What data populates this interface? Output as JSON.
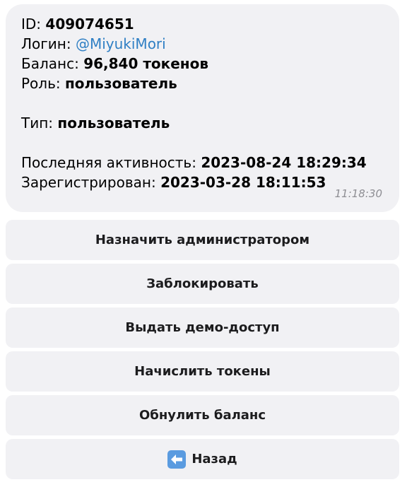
{
  "profile": {
    "id_label": "ID:",
    "id_value": "409074651",
    "login_label": "Логин:",
    "login_value": "@MiyukiMori",
    "balance_label": "Баланс:",
    "balance_value": "96,840 токенов",
    "role_label": "Роль:",
    "role_value": "пользователь",
    "type_label": "Тип:",
    "type_value": "пользователь",
    "last_active_label": "Последняя активность:",
    "last_active_value": "2023-08-24 18:29:34",
    "registered_label": "Зарегистрирован:",
    "registered_value": "2023-03-28 18:11:53",
    "time": "11:18:30"
  },
  "buttons": {
    "make_admin": "Назначить администратором",
    "block": "Заблокировать",
    "demo_access": "Выдать демо-доступ",
    "add_tokens": "Начислить токены",
    "reset_balance": "Обнулить баланс",
    "back": "Назад",
    "back_icon": "back-arrow-icon"
  },
  "colors": {
    "bubble_bg": "#f1f1f4",
    "link": "#2f7fc4",
    "back_icon_bg": "#5a9be0"
  }
}
